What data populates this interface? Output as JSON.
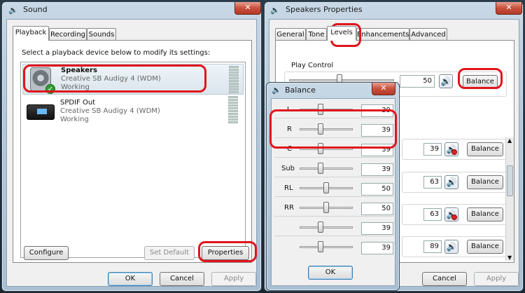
{
  "sound": {
    "title": "Sound",
    "tabs": [
      "Playback",
      "Recording",
      "Sounds"
    ],
    "instruction": "Select a playback device below to modify its settings:",
    "devices": [
      {
        "name": "Speakers",
        "driver": "Creative SB Audigy 4 (WDM)",
        "status": "Working"
      },
      {
        "name": "SPDIF Out",
        "driver": "Creative SB Audigy 4 (WDM)",
        "status": "Working"
      }
    ],
    "configure": "Configure",
    "set_default": "Set Default",
    "properties": "Properties",
    "ok": "OK",
    "cancel": "Cancel",
    "apply": "Apply"
  },
  "speakers": {
    "title": "Speakers Properties",
    "tabs": [
      "General",
      "Tone",
      "Levels",
      "Enhancements",
      "Advanced"
    ],
    "play_control_label": "Play Control",
    "play_control_value": "50",
    "balance": "Balance",
    "rows": [
      {
        "value": "39",
        "muted": true
      },
      {
        "value": "63",
        "muted": false
      },
      {
        "value": "63",
        "muted": true
      },
      {
        "value": "89",
        "muted": false
      }
    ],
    "cancel": "Cancel",
    "apply": "Apply"
  },
  "balance": {
    "title": "Balance",
    "channels": [
      {
        "label": "L",
        "value": "39"
      },
      {
        "label": "R",
        "value": "39"
      },
      {
        "label": "C",
        "value": "39"
      },
      {
        "label": "Sub",
        "value": "39"
      },
      {
        "label": "RL",
        "value": "50"
      },
      {
        "label": "RR",
        "value": "50"
      },
      {
        "label": "",
        "value": "39"
      },
      {
        "label": "",
        "value": "39"
      }
    ],
    "ok": "OK"
  },
  "colors": {
    "highlight": "#e0141b",
    "accent": "#1c4f8c"
  }
}
